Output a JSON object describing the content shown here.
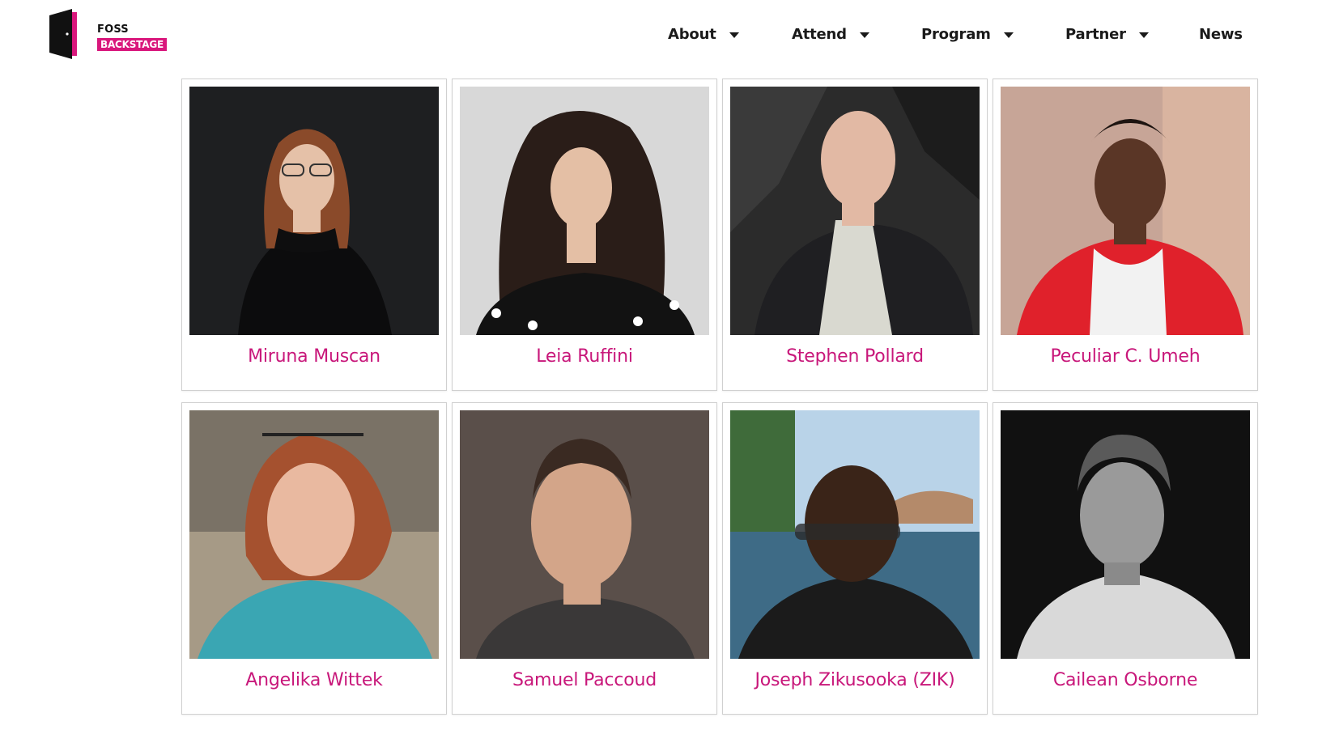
{
  "brand": {
    "logo_line1": "FOSS",
    "logo_line2": "BACKSTAGE",
    "accent_color": "#d9177c"
  },
  "nav": {
    "items": [
      {
        "label": "About",
        "has_dropdown": true
      },
      {
        "label": "Attend",
        "has_dropdown": true
      },
      {
        "label": "Program",
        "has_dropdown": true
      },
      {
        "label": "Partner",
        "has_dropdown": true
      },
      {
        "label": "News",
        "has_dropdown": false
      }
    ]
  },
  "speakers": [
    {
      "name": "Miruna Muscan",
      "photo": "portrait-photo"
    },
    {
      "name": "Leia Ruffini",
      "photo": "portrait-photo"
    },
    {
      "name": "Stephen Pollard",
      "photo": "portrait-photo"
    },
    {
      "name": "Peculiar C. Umeh",
      "photo": "portrait-photo"
    },
    {
      "name": "Angelika Wittek",
      "photo": "portrait-photo"
    },
    {
      "name": "Samuel Paccoud",
      "photo": "portrait-photo"
    },
    {
      "name": "Joseph Zikusooka (ZIK)",
      "photo": "portrait-photo"
    },
    {
      "name": "Cailean Osborne",
      "photo": "portrait-photo"
    }
  ],
  "colors": {
    "speaker_name": "#c8177a",
    "card_border": "#d0d0d0"
  }
}
